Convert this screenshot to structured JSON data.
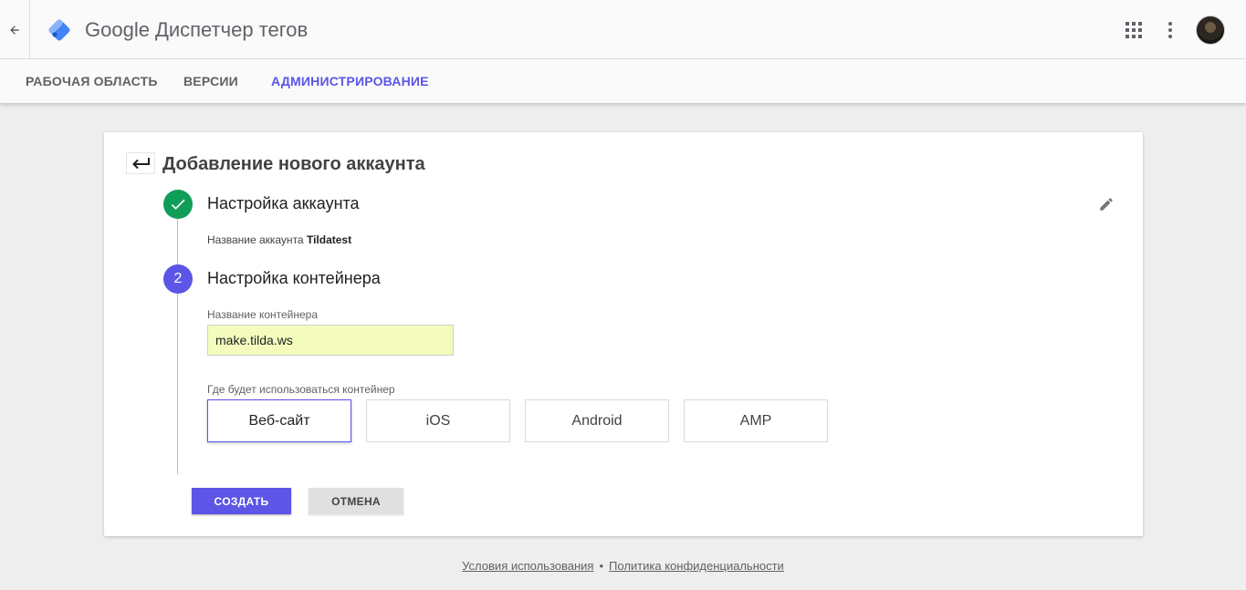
{
  "header": {
    "brand_google": "Google",
    "brand_product": "Диспетчер тегов",
    "icons": [
      "back-arrow-icon",
      "gtm-logo-icon",
      "apps-grid-icon",
      "more-vert-icon",
      "avatar"
    ]
  },
  "nav": {
    "tabs": [
      {
        "label": "РАБОЧАЯ ОБЛАСТЬ",
        "active": false
      },
      {
        "label": "ВЕРСИИ",
        "active": false
      },
      {
        "label": "АДМИНИСТРИРОВАНИЕ",
        "active": true
      }
    ]
  },
  "card": {
    "title": "Добавление нового аккаунта",
    "step1": {
      "title": "Настройка аккаунта",
      "summary_label": "Название аккаунта",
      "summary_value": "Tildatest"
    },
    "step2": {
      "number": "2",
      "title": "Настройка контейнера",
      "name_label": "Название контейнера",
      "name_value": "make.tilda.ws",
      "usage_label": "Где будет использоваться контейнер",
      "types": [
        {
          "label": "Веб-сайт",
          "selected": true
        },
        {
          "label": "iOS",
          "selected": false
        },
        {
          "label": "Android",
          "selected": false
        },
        {
          "label": "AMP",
          "selected": false
        }
      ]
    },
    "create_label": "СОЗДАТЬ",
    "cancel_label": "ОТМЕНА"
  },
  "footer": {
    "terms": "Условия использования",
    "separator": "•",
    "privacy": "Политика конфиденциальности"
  },
  "colors": {
    "accent": "#5c55e6",
    "success": "#0f9d58",
    "input_bg": "#f3fcbd",
    "page_bg": "#eeeeee"
  }
}
